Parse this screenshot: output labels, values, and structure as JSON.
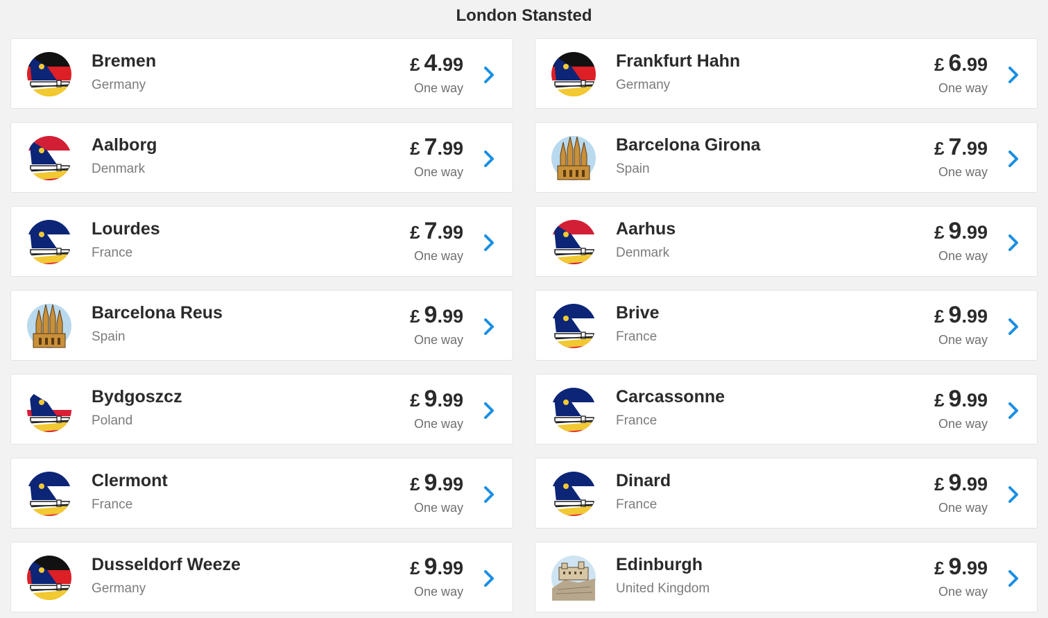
{
  "header": {
    "title": "London Stansted"
  },
  "colors": {
    "accent": "#1a8fe3",
    "ryanair_blue": "#0c2577",
    "ryanair_yellow": "#f1c933"
  },
  "destinations": [
    {
      "city": "Bremen",
      "country": "Germany",
      "currency": "£",
      "whole": "4",
      "decimal": ".99",
      "trip": "One way",
      "icon": "germany-ryanair-icon"
    },
    {
      "city": "Frankfurt Hahn",
      "country": "Germany",
      "currency": "£",
      "whole": "6",
      "decimal": ".99",
      "trip": "One way",
      "icon": "germany-ryanair-icon"
    },
    {
      "city": "Aalborg",
      "country": "Denmark",
      "currency": "£",
      "whole": "7",
      "decimal": ".99",
      "trip": "One way",
      "icon": "denmark-ryanair-icon"
    },
    {
      "city": "Barcelona Girona",
      "country": "Spain",
      "currency": "£",
      "whole": "7",
      "decimal": ".99",
      "trip": "One way",
      "icon": "sagrada-familia-icon"
    },
    {
      "city": "Lourdes",
      "country": "France",
      "currency": "£",
      "whole": "7",
      "decimal": ".99",
      "trip": "One way",
      "icon": "france-ryanair-icon"
    },
    {
      "city": "Aarhus",
      "country": "Denmark",
      "currency": "£",
      "whole": "9",
      "decimal": ".99",
      "trip": "One way",
      "icon": "denmark-ryanair-icon"
    },
    {
      "city": "Barcelona Reus",
      "country": "Spain",
      "currency": "£",
      "whole": "9",
      "decimal": ".99",
      "trip": "One way",
      "icon": "sagrada-familia-icon"
    },
    {
      "city": "Brive",
      "country": "France",
      "currency": "£",
      "whole": "9",
      "decimal": ".99",
      "trip": "One way",
      "icon": "france-ryanair-icon"
    },
    {
      "city": "Bydgoszcz",
      "country": "Poland",
      "currency": "£",
      "whole": "9",
      "decimal": ".99",
      "trip": "One way",
      "icon": "poland-ryanair-icon"
    },
    {
      "city": "Carcassonne",
      "country": "France",
      "currency": "£",
      "whole": "9",
      "decimal": ".99",
      "trip": "One way",
      "icon": "france-ryanair-icon"
    },
    {
      "city": "Clermont",
      "country": "France",
      "currency": "£",
      "whole": "9",
      "decimal": ".99",
      "trip": "One way",
      "icon": "france-ryanair-icon"
    },
    {
      "city": "Dinard",
      "country": "France",
      "currency": "£",
      "whole": "9",
      "decimal": ".99",
      "trip": "One way",
      "icon": "france-ryanair-icon"
    },
    {
      "city": "Dusseldorf Weeze",
      "country": "Germany",
      "currency": "£",
      "whole": "9",
      "decimal": ".99",
      "trip": "One way",
      "icon": "germany-ryanair-icon"
    },
    {
      "city": "Edinburgh",
      "country": "United Kingdom",
      "currency": "£",
      "whole": "9",
      "decimal": ".99",
      "trip": "One way",
      "icon": "edinburgh-castle-icon"
    }
  ]
}
